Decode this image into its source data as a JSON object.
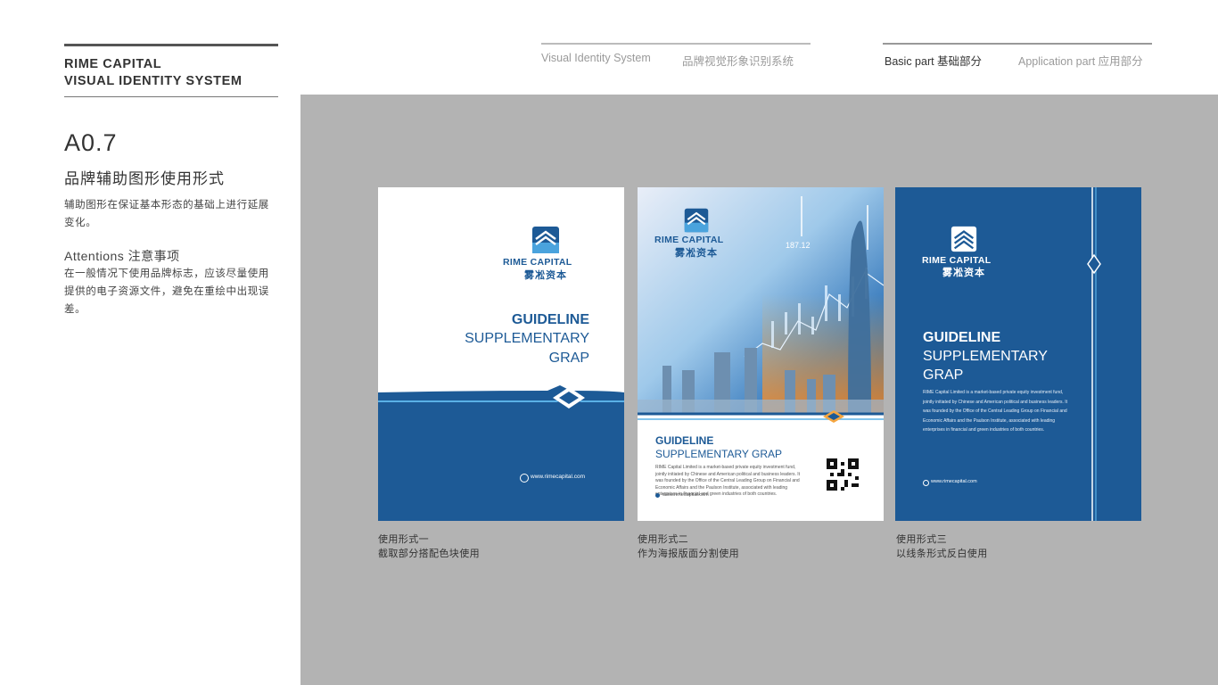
{
  "brand": {
    "line1": "RIME CAPITAL",
    "line2": "VISUAL IDENTITY SYSTEM"
  },
  "section": {
    "number": "A0.7",
    "title": "品牌辅助图形使用形式",
    "description": "辅助图形在保证基本形态的基础上进行延展变化。",
    "attentions_title": "Attentions 注意事项",
    "attentions_text": "在一般情况下使用品牌标志，应该尽量使用提供的电子资源文件，避免在重绘中出现误差。"
  },
  "nav": {
    "vis_en": "Visual Identity System",
    "vis_cn": "品牌视觉形象识别系统",
    "basic": "Basic part  基础部分",
    "application": "Application part  应用部分"
  },
  "cards": [
    {
      "logo_en": "RIME CAPITAL",
      "logo_cn": "雾凇资本",
      "title": "GUIDELINE",
      "sub1": "SUPPLEMENTARY",
      "sub2": "GRAP",
      "url": "www.rimecapital.com",
      "caption1": "使用形式一",
      "caption2": "截取部分搭配色块使用"
    },
    {
      "logo_en": "RIME CAPITAL",
      "logo_cn": "雾凇资本",
      "chart_label": "187.12",
      "title": "GUIDELINE",
      "sub": "SUPPLEMENTARY GRAP",
      "body": "RIME Capital Limited is a market-based private equity investment fund, jointly initiated by Chinese and American political and business leaders. It was founded by the Office of the Central Leading Group on Financial and Economic Affairs and the Paulson Institute, associated with leading enterprises in financial and green industries of both countries.",
      "url": "www.rimecapital.com",
      "caption1": "使用形式二",
      "caption2": "作为海报版面分割使用"
    },
    {
      "logo_en": "RIME CAPITAL",
      "logo_cn": "雾凇资本",
      "title": "GUIDELINE",
      "sub1": "SUPPLEMENTARY",
      "sub2": "GRAP",
      "body": "RIME Capital Limited is a market-based private equity investment fund, jointly initiated by Chinese and American political and business leaders. It was founded by the Office of the Central Leading Group on Financial and Economic Affairs and the Paulson Institute, associated with leading enterprises in financial and green industries of both countries.",
      "url": "www.rimecapital.com",
      "caption1": "使用形式三",
      "caption2": "以线条形式反白使用"
    }
  ],
  "colors": {
    "brand_blue": "#1d5a96",
    "accent_light": "#5ab0e6",
    "gray_bg": "#b3b3b3"
  }
}
